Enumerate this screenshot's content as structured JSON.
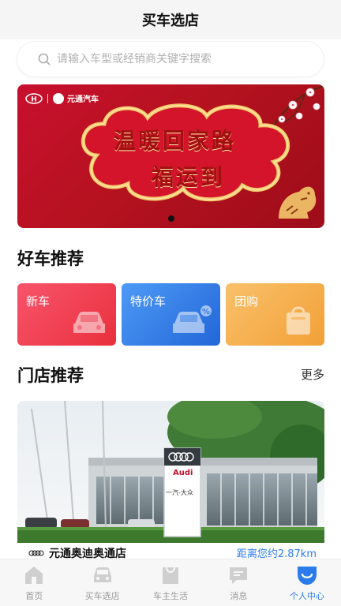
{
  "header": {
    "title": "买车选店"
  },
  "search": {
    "placeholder": "请输入车型或经销商关键字搜索"
  },
  "banner": {
    "brand_right": "元通汽车",
    "headline_1": "温暖回家路",
    "headline_2": "福运到",
    "active_dot": 1,
    "colors": {
      "bg": "#c8102e",
      "cloud": "#f3c96b"
    }
  },
  "recommend": {
    "title": "好车推荐",
    "cards": [
      {
        "label": "新车",
        "icon": "car-icon",
        "color": "#ee3a4a"
      },
      {
        "label": "特价车",
        "icon": "car-discount-icon",
        "color": "#3a82ea"
      },
      {
        "label": "团购",
        "icon": "bag-icon",
        "color": "#f4ad4a"
      }
    ]
  },
  "stores": {
    "title": "门店推荐",
    "more_label": "更多",
    "items": [
      {
        "name": "元通奥迪奥通店",
        "distance": "距离您约2.87km",
        "sign_brand": "Audi",
        "sign_text": "一汽-大众"
      }
    ]
  },
  "tabbar": {
    "items": [
      {
        "label": "首页",
        "icon": "home-icon",
        "active": false
      },
      {
        "label": "买车选店",
        "icon": "car-icon",
        "active": false
      },
      {
        "label": "车主生活",
        "icon": "shopping-bag-icon",
        "active": false
      },
      {
        "label": "消息",
        "icon": "message-icon",
        "active": false
      },
      {
        "label": "个人中心",
        "icon": "profile-icon",
        "active": true
      }
    ],
    "colors": {
      "inactive": "#cfcfcf",
      "active": "#2b7bea"
    }
  }
}
